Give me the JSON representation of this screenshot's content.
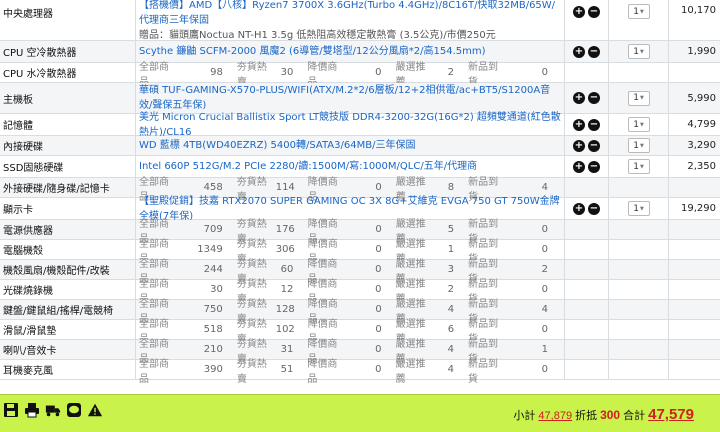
{
  "rows": [
    {
      "category": "中央處理器",
      "product": "【搭機價】AMD【八核】Ryzen7 3700X 3.6GHz(Turbo 4.4GHz)/8C16T/快取32MB/65W/代理商三年保固",
      "gift": "贈品：貓頭鷹Noctua NT-H1 3.5g 低熱阻高效穩定散熱膏 (3.5公克)/市價250元",
      "qty": "1",
      "price": "10,170"
    },
    {
      "category": "CPU 空冷散熱器",
      "product": "Scythe 鐮鼬 SCFM-2000 風魔2 (6導管/雙塔型/12公分風扇*2/高154.5mm)",
      "qty": "1",
      "price": "1,990"
    },
    {
      "category": "CPU 水冷散熱器",
      "stats": [
        "98",
        "30",
        "0",
        "2",
        "0"
      ]
    },
    {
      "category": "主機板",
      "product": "華碩 TUF-GAMING-X570-PLUS/WIFI(ATX/M.2*2/6層板/12+2相供電/ac+BT5/S1200A音效/聲保五年保)",
      "qty": "1",
      "price": "5,990"
    },
    {
      "category": "記憶體",
      "product": "美光 Micron Crucial Ballistix Sport LT競技版 DDR4-3200-32G(16G*2) 超頻雙通道(紅色散熱片)/CL16",
      "qty": "1",
      "price": "4,799"
    },
    {
      "category": "內接硬碟",
      "product": "WD 藍標 4TB(WD40EZRZ) 5400轉/SATA3/64MB/三年保固",
      "qty": "1",
      "price": "3,290"
    },
    {
      "category": "SSD固態硬碟",
      "product": "Intel 660P 512G/M.2 PCIe 2280/讀:1500M/寫:1000M/QLC/五年/代理商",
      "qty": "1",
      "price": "2,350"
    },
    {
      "category": "外接硬碟/隨身碟/記憶卡",
      "stats": [
        "458",
        "114",
        "0",
        "8",
        "4"
      ]
    },
    {
      "category": "顯示卡",
      "product": "【聖殿促銷】技嘉 RTX2070 SUPER GAMING OC 3X 8G+艾維克 EVGA 750 GT 750W金牌全模(7年保)",
      "qty": "1",
      "price": "19,290"
    },
    {
      "category": "電源供應器",
      "stats": [
        "709",
        "176",
        "0",
        "5",
        "0"
      ]
    },
    {
      "category": "電腦機殼",
      "stats": [
        "1349",
        "306",
        "0",
        "1",
        "0"
      ]
    },
    {
      "category": "機殼風扇/機殼配件/改裝",
      "stats": [
        "244",
        "60",
        "0",
        "3",
        "2"
      ]
    },
    {
      "category": "光碟燒錄機",
      "stats": [
        "30",
        "12",
        "0",
        "2",
        "0"
      ]
    },
    {
      "category": "鍵盤/鍵鼠組/搖桿/電競椅",
      "stats": [
        "750",
        "128",
        "0",
        "4",
        "4"
      ]
    },
    {
      "category": "滑鼠/滑鼠墊",
      "stats": [
        "518",
        "102",
        "0",
        "6",
        "0"
      ]
    },
    {
      "category": "喇叭/音效卡",
      "stats": [
        "210",
        "31",
        "0",
        "4",
        "1"
      ]
    },
    {
      "category": "耳機麥克風",
      "stats": [
        "390",
        "51",
        "0",
        "4",
        "0"
      ]
    }
  ],
  "stat_labels": [
    "全部商品",
    "夯貨熱賣",
    "降價商品",
    "嚴選推薦",
    "新品到貨"
  ],
  "icons": [
    "save-icon",
    "print-icon",
    "truck-icon",
    "line-chat-icon",
    "warning-icon"
  ],
  "footer": {
    "subtotal_label": "小計",
    "subtotal": "47,879",
    "discount_label": "折抵",
    "discount": "300",
    "total_label": "合計",
    "total": "47,579"
  },
  "colors": {
    "footer_bg": "#c9f24a",
    "link": "#1a66c7",
    "total": "#d01f1f"
  }
}
